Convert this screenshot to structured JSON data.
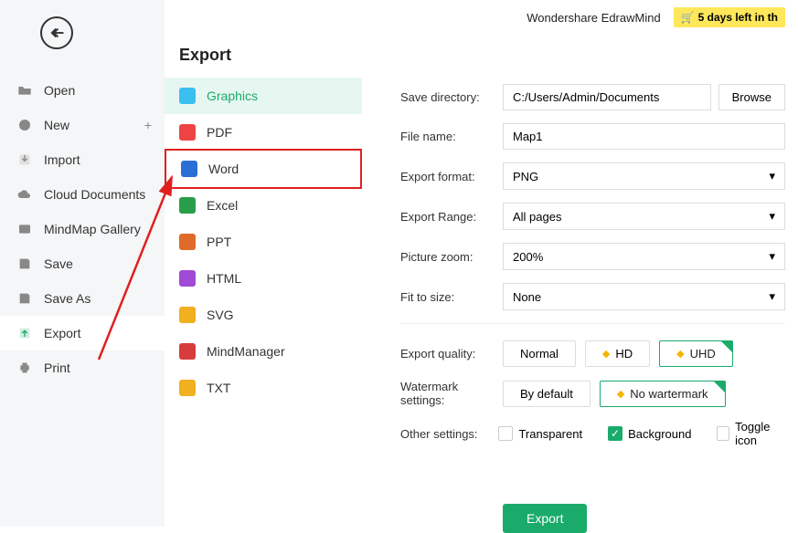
{
  "app": {
    "name": "Wondershare EdrawMind",
    "trial": "5 days left in th"
  },
  "sidebar": {
    "items": [
      {
        "label": "Open"
      },
      {
        "label": "New"
      },
      {
        "label": "Import"
      },
      {
        "label": "Cloud Documents"
      },
      {
        "label": "MindMap Gallery"
      },
      {
        "label": "Save"
      },
      {
        "label": "Save As"
      },
      {
        "label": "Export"
      },
      {
        "label": "Print"
      }
    ]
  },
  "export": {
    "title": "Export",
    "formats": [
      {
        "label": "Graphics",
        "color": "#3bbff0"
      },
      {
        "label": "PDF",
        "color": "#e44"
      },
      {
        "label": "Word",
        "color": "#2a6fd6"
      },
      {
        "label": "Excel",
        "color": "#2a9d4a"
      },
      {
        "label": "PPT",
        "color": "#e06a2a"
      },
      {
        "label": "HTML",
        "color": "#a04ad6"
      },
      {
        "label": "SVG",
        "color": "#f0b020"
      },
      {
        "label": "MindManager",
        "color": "#d63c3c"
      },
      {
        "label": "TXT",
        "color": "#f0b020"
      }
    ]
  },
  "settings": {
    "save_dir_label": "Save directory:",
    "save_dir": "C:/Users/Admin/Documents",
    "browse": "Browse",
    "file_name_label": "File name:",
    "file_name": "Map1",
    "format_label": "Export format:",
    "format": "PNG",
    "range_label": "Export Range:",
    "range": "All pages",
    "zoom_label": "Picture zoom:",
    "zoom": "200%",
    "fit_label": "Fit to size:",
    "fit": "None",
    "quality_label": "Export quality:",
    "quality": {
      "normal": "Normal",
      "hd": "HD",
      "uhd": "UHD"
    },
    "watermark_label": "Watermark settings:",
    "watermark": {
      "default": "By default",
      "none": "No wartermark"
    },
    "other_label": "Other settings:",
    "transparent": "Transparent",
    "background": "Background",
    "toggle_icon": "Toggle icon",
    "export_btn": "Export"
  }
}
